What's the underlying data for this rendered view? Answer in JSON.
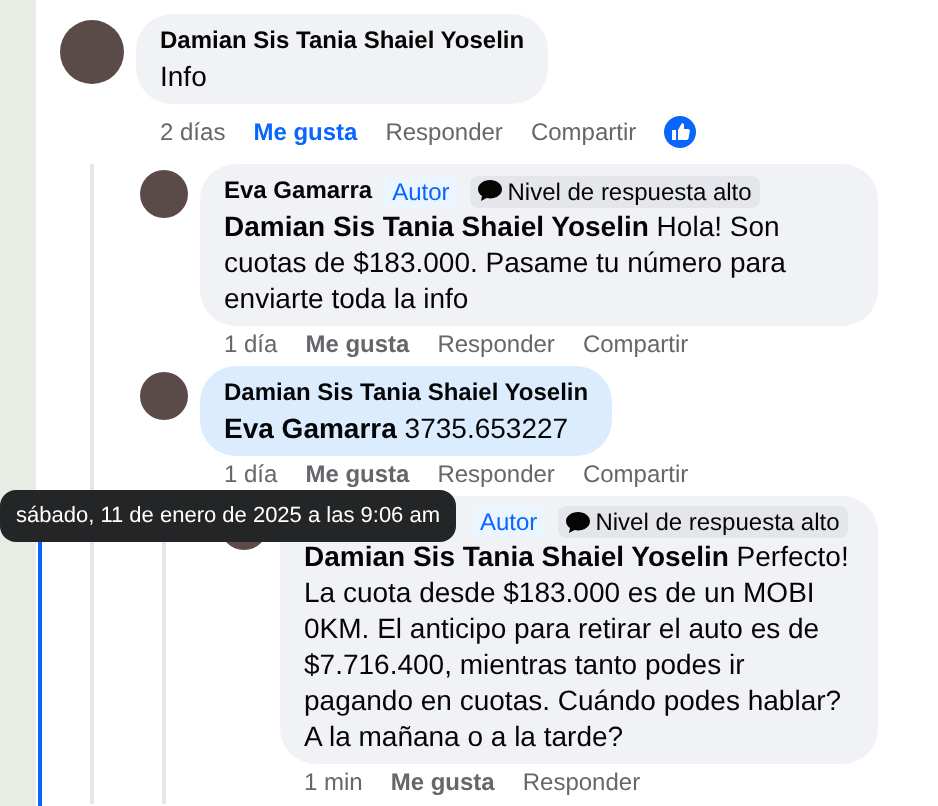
{
  "comments": [
    {
      "author": "Damian Sis Tania Shaiel Yoselin",
      "text": "Info",
      "highlighted": false,
      "time": "2 días",
      "like": "Me gusta",
      "liked": true,
      "reply": "Responder",
      "share": "Compartir",
      "reaction": true,
      "children": [
        {
          "author": "Eva Gamarra",
          "badges": [
            {
              "kind": "author",
              "label": "Autor"
            },
            {
              "kind": "responder",
              "label": "Nivel de respuesta alto"
            }
          ],
          "text": "**Damian Sis Tania Shaiel Yoselin** Hola! Son cuotas de $183.000. Pasame tu número para enviarte toda la info",
          "highlighted": false,
          "time": "1 día",
          "like": "Me gusta",
          "liked": false,
          "reply": "Responder",
          "share": "Compartir"
        },
        {
          "author": "Damian Sis Tania Shaiel Yoselin",
          "text": "**Eva Gamarra** 3735.653227",
          "highlighted": true,
          "time": "1 día",
          "like": "Me gusta",
          "liked": false,
          "reply": "Responder",
          "share": "Compartir",
          "children": [
            {
              "badges": [
                {
                  "kind": "author",
                  "label": "Autor"
                },
                {
                  "kind": "responder",
                  "label": "Nivel de respuesta alto"
                }
              ],
              "text": "**Damian Sis Tania Shaiel Yoselin** Perfecto! La cuota desde $183.000 es de un MOBI 0KM. El anticipo para retirar el auto es de $7.716.400, mientras tanto podes ir pagando en cuotas. Cuándo podes hablar? A la mañana o a la tarde?",
              "highlighted": false,
              "time": "1 min",
              "like": "Me gusta",
              "liked": false,
              "reply": "Responder"
            }
          ]
        }
      ]
    }
  ],
  "tooltip": "sábado, 11 de enero de 2025 a las 9:06 am"
}
